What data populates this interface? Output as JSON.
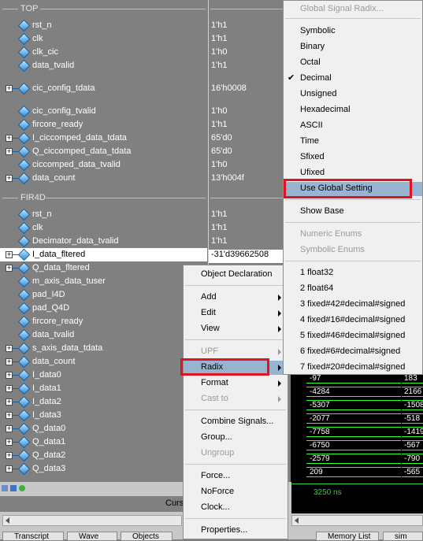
{
  "groups": {
    "top": "TOP",
    "fir": "FIR4D"
  },
  "signals": [
    {
      "label": "rst_n",
      "value": "1'h1"
    },
    {
      "label": "clk",
      "value": "1'h1"
    },
    {
      "label": "clk_cic",
      "value": "1'h0"
    },
    {
      "label": "data_tvalid",
      "value": "1'h1"
    },
    {
      "label": "cic_config_tdata",
      "value": "16'h0008"
    },
    {
      "label": "cic_config_tvalid",
      "value": "1'h0"
    },
    {
      "label": "fircore_ready",
      "value": "1'h1"
    },
    {
      "label": "I_ciccomped_data_tdata",
      "value": "65'd0"
    },
    {
      "label": "Q_ciccomped_data_tdata",
      "value": "65'd0"
    },
    {
      "label": "ciccomped_data_tvalid",
      "value": "1'h0"
    },
    {
      "label": "data_count",
      "value": "13'h004f"
    },
    {
      "label": "rst_n",
      "value": "1'h1"
    },
    {
      "label": "clk",
      "value": "1'h1"
    },
    {
      "label": "Decimator_data_tvalid",
      "value": "1'h1"
    },
    {
      "label": "I_data_fltered",
      "value": "-31'd39662508"
    },
    {
      "label": "Q_data_fltered",
      "value": ""
    },
    {
      "label": "m_axis_data_tuser",
      "value": ""
    },
    {
      "label": "pad_I4D",
      "value": ""
    },
    {
      "label": "pad_Q4D",
      "value": ""
    },
    {
      "label": "fircore_ready",
      "value": ""
    },
    {
      "label": "data_tvalid",
      "value": ""
    },
    {
      "label": "s_axis_data_tdata",
      "value": ""
    },
    {
      "label": "data_count",
      "value": ""
    },
    {
      "label": "I_data0",
      "value": ""
    },
    {
      "label": "I_data1",
      "value": ""
    },
    {
      "label": "I_data2",
      "value": ""
    },
    {
      "label": "I_data3",
      "value": ""
    },
    {
      "label": "Q_data0",
      "value": ""
    },
    {
      "label": "Q_data1",
      "value": ""
    },
    {
      "label": "Q_data2",
      "value": ""
    },
    {
      "label": "Q_data3",
      "value": ""
    }
  ],
  "wave": {
    "rows": [
      {
        "left": "-97",
        "right": "183"
      },
      {
        "left": "-4284",
        "right": "2166"
      },
      {
        "left": "-5307",
        "right": "-1508"
      },
      {
        "left": "-2077",
        "right": "-518"
      },
      {
        "left": "-7758",
        "right": "-1419"
      },
      {
        "left": "-6750",
        "right": "-567"
      },
      {
        "left": "-2579",
        "right": "-790"
      },
      {
        "left": "209",
        "right": "-565"
      }
    ],
    "time": "3250 ns"
  },
  "bottom": {
    "cursor_label": "Curs"
  },
  "tabs": [
    "Transcript",
    "Wave",
    "Objects",
    "Memory List",
    "sim"
  ],
  "context_menu": {
    "items": [
      {
        "label": "Object Declaration",
        "submenu": false,
        "disabled": false
      },
      {
        "label": "Add",
        "submenu": true,
        "disabled": false
      },
      {
        "label": "Edit",
        "submenu": true,
        "disabled": false
      },
      {
        "label": "View",
        "submenu": true,
        "disabled": false
      },
      {
        "label": "UPF",
        "submenu": true,
        "disabled": true
      },
      {
        "label": "Radix",
        "submenu": true,
        "disabled": false
      },
      {
        "label": "Format",
        "submenu": true,
        "disabled": false
      },
      {
        "label": "Cast to",
        "submenu": true,
        "disabled": true
      },
      {
        "label": "Combine Signals...",
        "submenu": false,
        "disabled": false
      },
      {
        "label": "Group...",
        "submenu": false,
        "disabled": false
      },
      {
        "label": "Ungroup",
        "submenu": false,
        "disabled": true
      },
      {
        "label": "Force...",
        "submenu": false,
        "disabled": false
      },
      {
        "label": "NoForce",
        "submenu": false,
        "disabled": false
      },
      {
        "label": "Clock...",
        "submenu": false,
        "disabled": false
      },
      {
        "label": "Properties...",
        "submenu": false,
        "disabled": false
      }
    ]
  },
  "radix_menu": {
    "items": [
      {
        "label": "Global Signal Radix...",
        "disabled": true
      },
      {
        "label": "Symbolic"
      },
      {
        "label": "Binary"
      },
      {
        "label": "Octal"
      },
      {
        "label": "Decimal",
        "checked": true
      },
      {
        "label": "Unsigned"
      },
      {
        "label": "Hexadecimal"
      },
      {
        "label": "ASCII"
      },
      {
        "label": "Time"
      },
      {
        "label": "Sfixed"
      },
      {
        "label": "Ufixed"
      },
      {
        "label": "Use Global Setting"
      },
      {
        "label": "Show Base"
      },
      {
        "label": "Numeric Enums",
        "disabled": true
      },
      {
        "label": "Symbolic Enums",
        "disabled": true
      },
      {
        "label": "1 float32"
      },
      {
        "label": "2 float64"
      },
      {
        "label": "3 fixed#42#decimal#signed"
      },
      {
        "label": "4 fixed#16#decimal#signed"
      },
      {
        "label": "5 fixed#46#decimal#signed"
      },
      {
        "label": "6 fixed#6#decimal#signed"
      },
      {
        "label": "7 fixed#20#decimal#signed"
      }
    ],
    "check_mark": "✔"
  },
  "colors": {
    "highlight_box": "#e0141e",
    "menu_select": "#99b4d1",
    "wave_green": "#33ff33"
  }
}
